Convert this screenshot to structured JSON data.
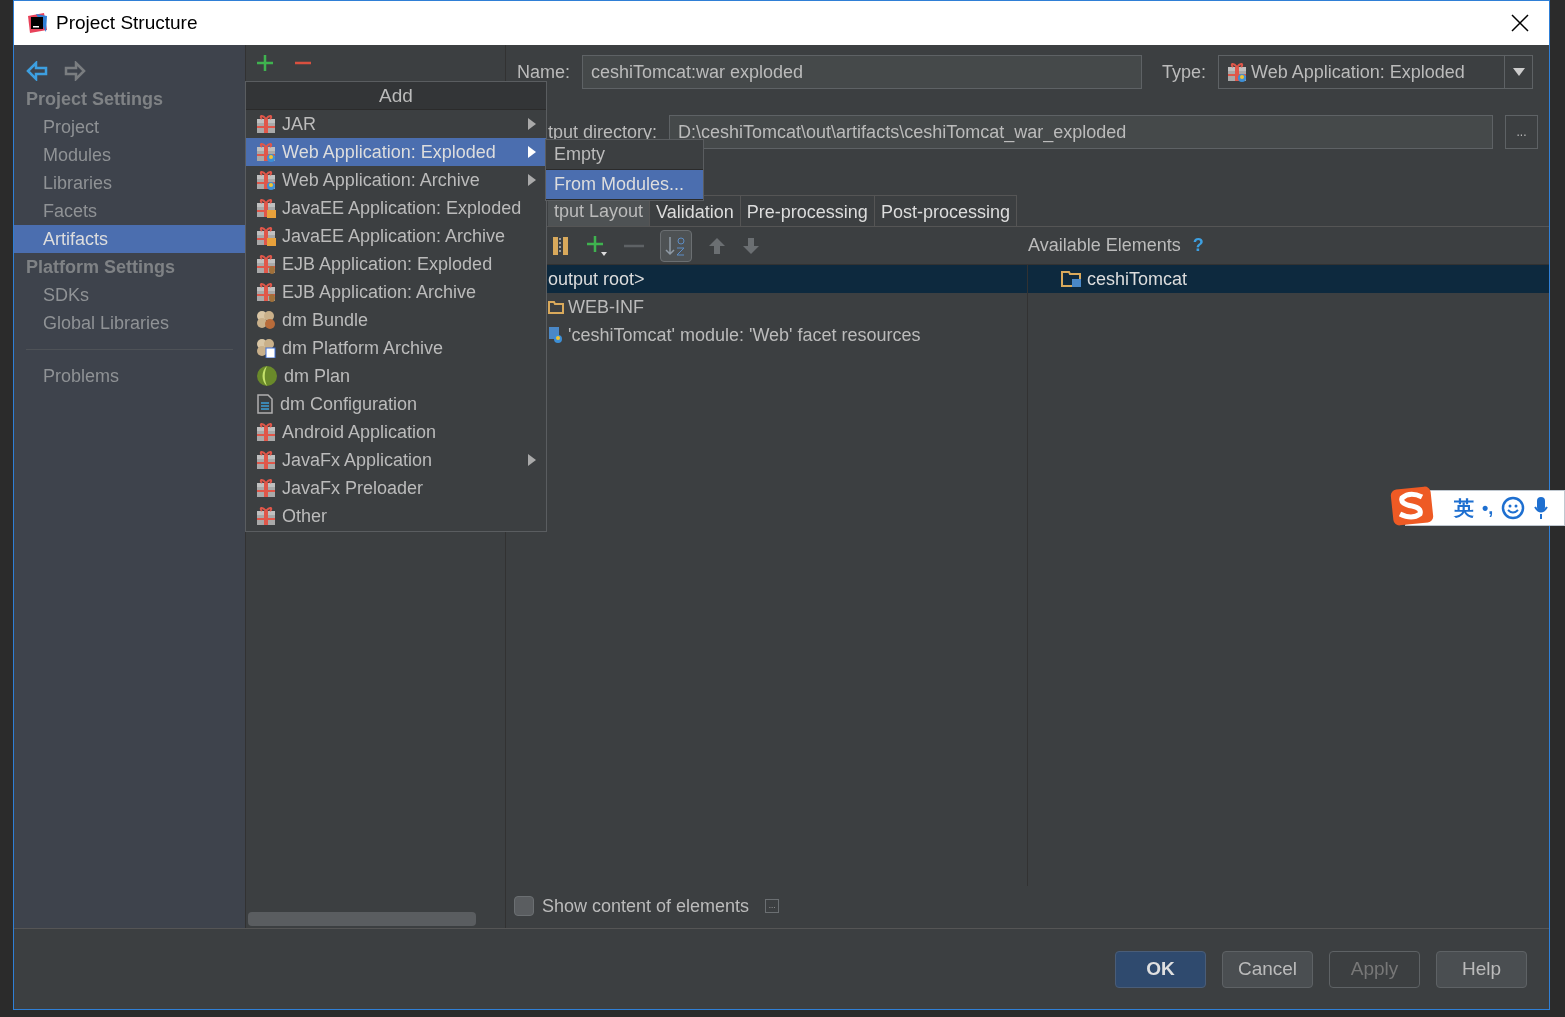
{
  "window": {
    "title": "Project Structure"
  },
  "nav": {
    "sections": [
      {
        "heading": "Project Settings",
        "items": [
          {
            "label": "Project",
            "selected": false
          },
          {
            "label": "Modules",
            "selected": false
          },
          {
            "label": "Libraries",
            "selected": false
          },
          {
            "label": "Facets",
            "selected": false
          },
          {
            "label": "Artifacts",
            "selected": true
          }
        ]
      },
      {
        "heading": "Platform Settings",
        "items": [
          {
            "label": "SDKs",
            "selected": false
          },
          {
            "label": "Global Libraries",
            "selected": false
          }
        ]
      }
    ],
    "problems": "Problems"
  },
  "add_popup": {
    "title": "Add",
    "items": [
      {
        "label": "JAR",
        "kind": "gift",
        "submenu": true,
        "selected": false
      },
      {
        "label": "Web Application: Exploded",
        "kind": "gift-web",
        "submenu": true,
        "selected": true
      },
      {
        "label": "Web Application: Archive",
        "kind": "gift-web",
        "submenu": true,
        "selected": false
      },
      {
        "label": "JavaEE Application: Exploded",
        "kind": "gift-ee",
        "submenu": false,
        "selected": false
      },
      {
        "label": "JavaEE Application: Archive",
        "kind": "gift-ee",
        "submenu": false,
        "selected": false
      },
      {
        "label": "EJB Application: Exploded",
        "kind": "gift-ejb",
        "submenu": false,
        "selected": false
      },
      {
        "label": "EJB Application: Archive",
        "kind": "gift-ejb",
        "submenu": false,
        "selected": false
      },
      {
        "label": "dm Bundle",
        "kind": "bundle",
        "submenu": false,
        "selected": false
      },
      {
        "label": "dm Platform Archive",
        "kind": "bundle-archive",
        "submenu": false,
        "selected": false
      },
      {
        "label": "dm Plan",
        "kind": "plan",
        "submenu": false,
        "selected": false
      },
      {
        "label": "dm Configuration",
        "kind": "config",
        "submenu": false,
        "selected": false
      },
      {
        "label": "Android Application",
        "kind": "gift",
        "submenu": false,
        "selected": false
      },
      {
        "label": "JavaFx Application",
        "kind": "gift",
        "submenu": true,
        "selected": false
      },
      {
        "label": "JavaFx Preloader",
        "kind": "gift",
        "submenu": false,
        "selected": false
      },
      {
        "label": "Other",
        "kind": "gift",
        "submenu": false,
        "selected": false
      }
    ]
  },
  "submenu": {
    "items": [
      {
        "label": "Empty",
        "selected": false
      },
      {
        "label": "From Modules...",
        "selected": true
      }
    ]
  },
  "artifact": {
    "name_label": "Name:",
    "name": "ceshiTomcat:war exploded",
    "type_label": "Type:",
    "type": "Web Application: Exploded",
    "output_label": "tput directory:",
    "output_dir": "D:\\ceshiTomcat\\out\\artifacts\\ceshiTomcat_war_exploded",
    "browse": "..."
  },
  "tabs": [
    {
      "label": "tput Layout",
      "selected": true
    },
    {
      "label": "Validation",
      "selected": false
    },
    {
      "label": "Pre-processing",
      "selected": false
    },
    {
      "label": "Post-processing",
      "selected": false
    }
  ],
  "toolbar": {
    "sort_alphabetically": true
  },
  "layout_tree": [
    {
      "label": "output root>",
      "kind": "root",
      "selected": true
    },
    {
      "label": "WEB-INF",
      "kind": "folder",
      "selected": false
    },
    {
      "label": "'ceshiTomcat' module: 'Web' facet resources",
      "kind": "facet",
      "selected": false
    }
  ],
  "available": {
    "heading": "Available Elements",
    "help": "?",
    "items": [
      {
        "label": "ceshiTomcat",
        "selected": true
      }
    ]
  },
  "show_content": {
    "label": "Show content of elements",
    "checked": false,
    "more": "..."
  },
  "buttons": [
    {
      "label": "OK",
      "kind": "default"
    },
    {
      "label": "Cancel",
      "kind": "normal"
    },
    {
      "label": "Apply",
      "kind": "disabled"
    },
    {
      "label": "Help",
      "kind": "normal"
    }
  ],
  "ime": {
    "mode": "英",
    "punct": "•,"
  }
}
